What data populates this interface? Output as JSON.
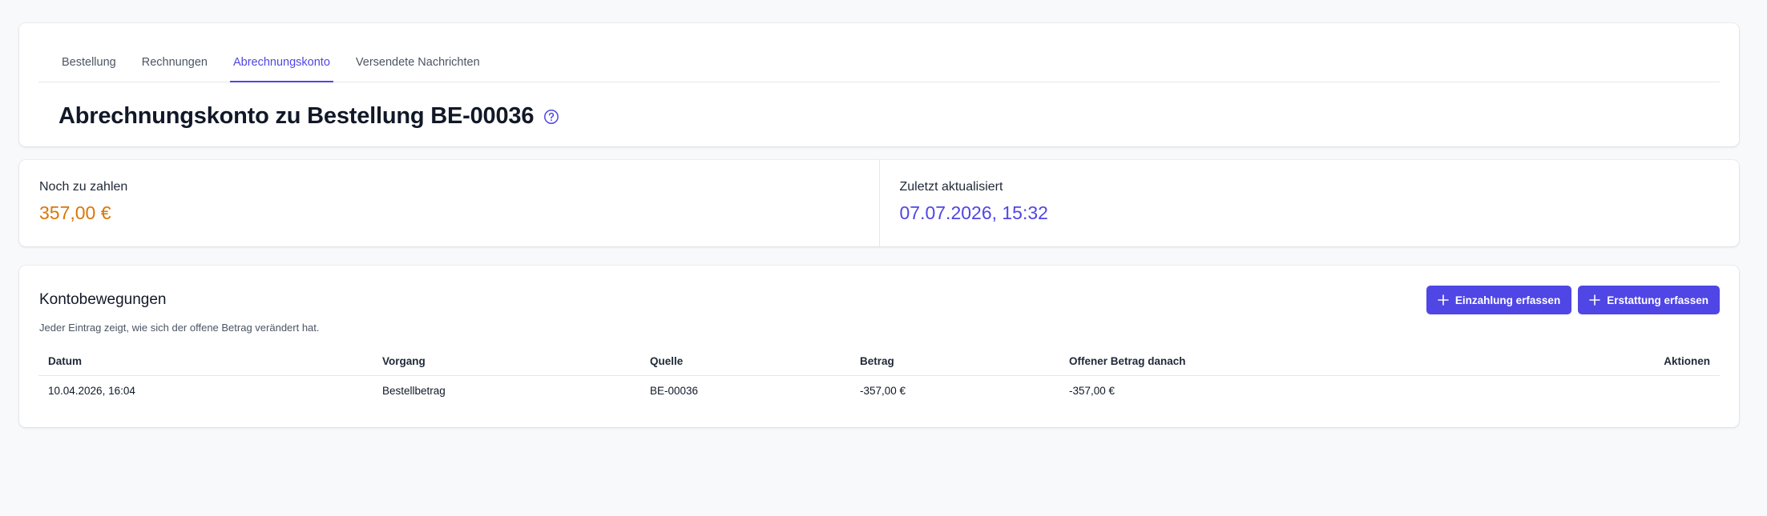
{
  "tabs": [
    {
      "label": "Bestellung"
    },
    {
      "label": "Rechnungen"
    },
    {
      "label": "Abrechnungskonto",
      "active": true
    },
    {
      "label": "Versendete Nachrichten"
    }
  ],
  "page": {
    "title": "Abrechnungskonto zu Bestellung BE-00036",
    "help_icon": "question-circle-icon"
  },
  "stats": {
    "due": {
      "label": "Noch zu zahlen",
      "value": "357,00 €",
      "color": "#d97706"
    },
    "updated": {
      "label": "Zuletzt aktualisiert",
      "value": "07.07.2026, 15:32",
      "color": "#4f46e5"
    }
  },
  "transactions": {
    "title": "Kontobewegungen",
    "subtitle": "Jeder Eintrag zeigt, wie sich der offene Betrag verändert hat.",
    "buttons": {
      "deposit": "Einzahlung erfassen",
      "refund": "Erstattung erfassen"
    },
    "columns": [
      "Datum",
      "Vorgang",
      "Quelle",
      "Betrag",
      "Offener Betrag danach",
      "Aktionen"
    ],
    "rows": [
      {
        "date": "10.04.2026, 16:04",
        "process": "Bestellbetrag",
        "source": "BE-00036",
        "amount": "-357,00 €",
        "open_after": "-357,00 €",
        "actions": ""
      }
    ]
  },
  "colors": {
    "accent": "#4f46e5",
    "warning": "#d97706",
    "background": "#f8f9fb"
  }
}
